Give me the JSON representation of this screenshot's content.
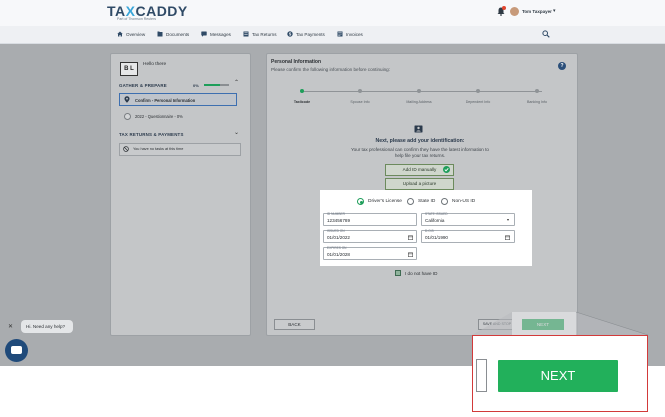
{
  "header": {
    "logo_text_a": "TA",
    "logo_text_x": "X",
    "logo_text_b": "CADDY",
    "logo_sub": "Part of Thomson Reuters",
    "user_name": "Tom Taxpayer"
  },
  "nav": {
    "items": [
      {
        "label": "Overview",
        "icon": "home-icon"
      },
      {
        "label": "Documents",
        "icon": "documents-icon"
      },
      {
        "label": "Messages",
        "icon": "messages-icon"
      },
      {
        "label": "Tax Returns",
        "icon": "tax-returns-icon"
      },
      {
        "label": "Tax Payments",
        "icon": "dollar-icon"
      },
      {
        "label": "Invoices",
        "icon": "invoice-icon"
      }
    ]
  },
  "sidebar": {
    "logo_text": "B L",
    "greeting": "Hello there",
    "gather_title": "GATHER & PREPARE",
    "gather_pct": "0%",
    "gather_progress": 0.62,
    "items": [
      {
        "label": "Confirm - Personal Information",
        "active": true
      },
      {
        "label": "2022 - Questionnaire - 0%",
        "active": false
      }
    ],
    "returns_title": "TAX RETURNS & PAYMENTS",
    "returns_empty": "You have no tasks at this time"
  },
  "main": {
    "title": "Personal Information",
    "subtitle": "Please confirm the following information before continuing:",
    "steps": [
      "Taxlicode",
      "Spouse Info",
      "Mailing Address",
      "Dependent Info",
      "Banking Info"
    ],
    "active_step": 0,
    "id_title": "Next, please add your identification:",
    "id_desc_1": "Your tax professional can confirm they have the latest information to",
    "id_desc_2": "help file your tax returns.",
    "add_manual_label": "Add ID manually",
    "upload_label": "Upload a picture",
    "no_id_label": "I do not have ID",
    "back_label": "BACK",
    "save_label": "SAVE AND STOP",
    "next_label": "NEXT"
  },
  "id_form": {
    "types": [
      {
        "label": "Driver's License",
        "selected": true
      },
      {
        "label": "State ID",
        "selected": false
      },
      {
        "label": "Non-US ID",
        "selected": false
      }
    ],
    "id_number_label": "ID NUMBER",
    "id_number_value": "123456789",
    "state_label": "STATE ISSUED",
    "state_value": "California",
    "issued_label": "ISSUED ON",
    "issued_value": "01/01/2022",
    "dob_label": "D.O.B",
    "dob_value": "01/01/1990",
    "expires_label": "EXPIRES ON",
    "expires_value": "01/01/2028"
  },
  "chat": {
    "prompt": "Hi. Need any help?"
  },
  "zoom": {
    "next_label": "NEXT"
  },
  "colors": {
    "brand_navy": "#2f4a66",
    "brand_blue": "#3aa6d9",
    "accent_green": "#22b05b",
    "highlight_red": "#d23a3a"
  }
}
